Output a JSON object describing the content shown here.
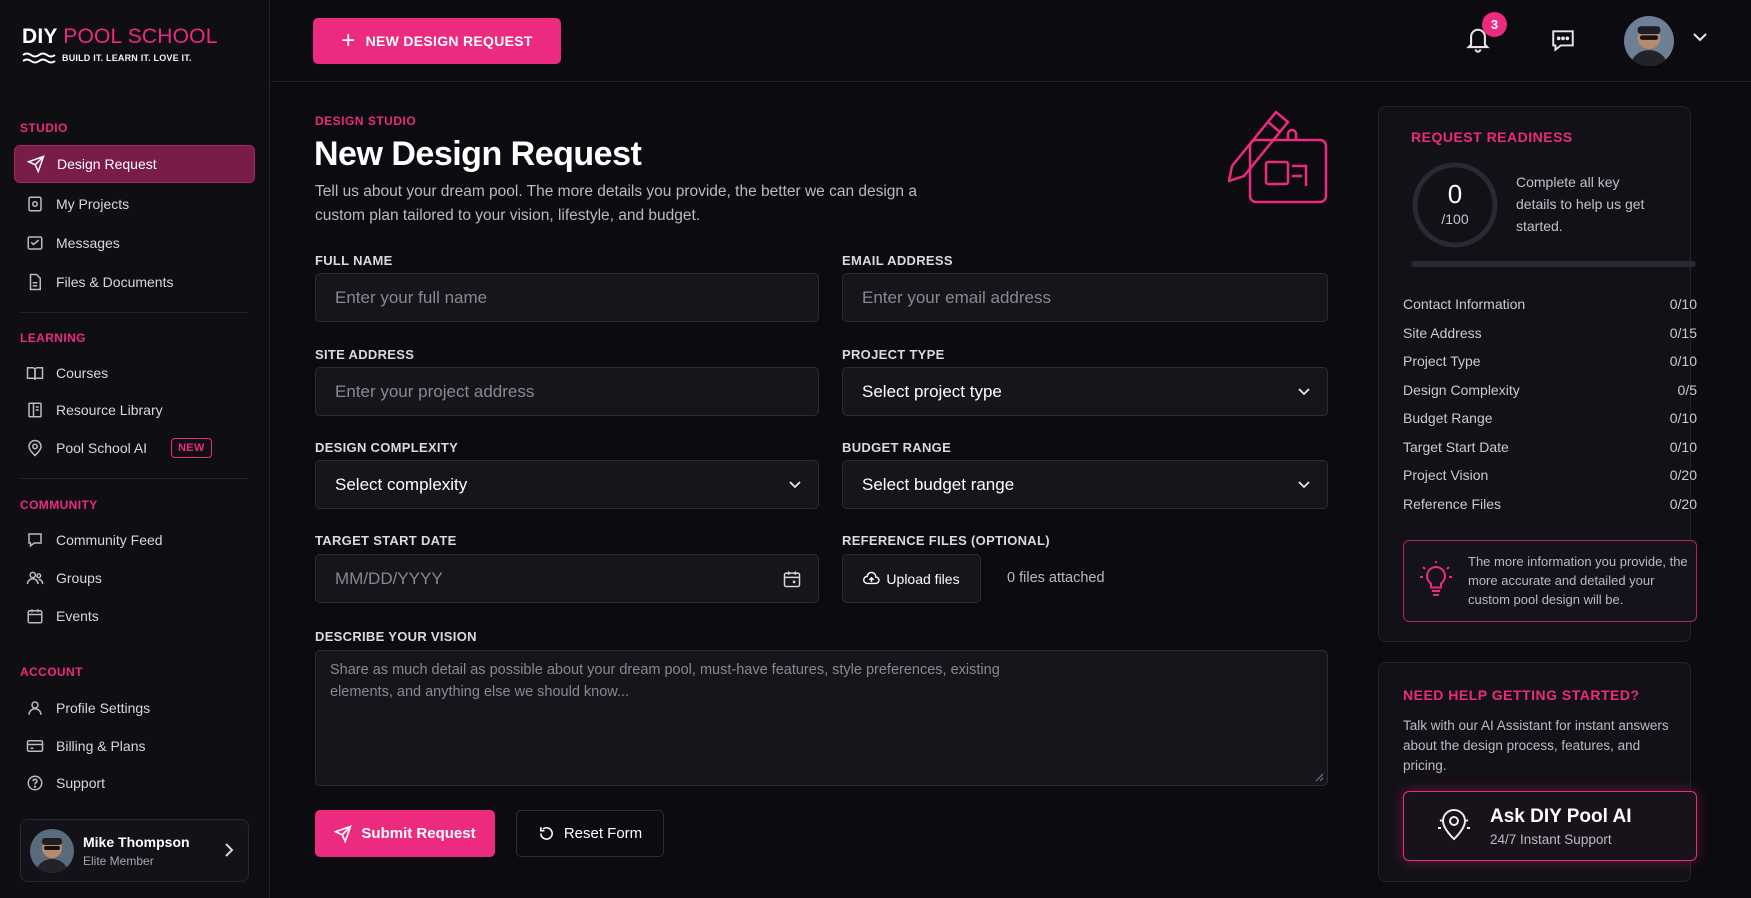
{
  "brand": {
    "name_part1": "DIY",
    "name_part2": "POOL SCHOOL",
    "tagline": "BUILD IT. LEARN IT. LOVE IT."
  },
  "sidebar": {
    "sections": [
      {
        "heading": "STUDIO",
        "items": [
          {
            "label": "Design Request",
            "icon": "send-icon",
            "active": true
          },
          {
            "label": "My Projects",
            "icon": "projects-icon"
          },
          {
            "label": "Messages",
            "icon": "messages-icon"
          },
          {
            "label": "Files & Documents",
            "icon": "file-icon"
          }
        ]
      },
      {
        "heading": "LEARNING",
        "items": [
          {
            "label": "Courses",
            "icon": "book-icon"
          },
          {
            "label": "Resource Library",
            "icon": "library-icon"
          },
          {
            "label": "Pool School AI",
            "icon": "ai-icon",
            "badge": "NEW"
          }
        ]
      },
      {
        "heading": "COMMUNITY",
        "items": [
          {
            "label": "Community Feed",
            "icon": "feed-icon"
          },
          {
            "label": "Groups",
            "icon": "groups-icon"
          },
          {
            "label": "Events",
            "icon": "calendar-icon"
          }
        ]
      },
      {
        "heading": "ACCOUNT",
        "items": [
          {
            "label": "Profile Settings",
            "icon": "user-icon"
          },
          {
            "label": "Billing & Plans",
            "icon": "billing-icon"
          },
          {
            "label": "Support",
            "icon": "help-icon"
          }
        ]
      }
    ],
    "user": {
      "name": "Mike Thompson",
      "role": "Elite Member"
    }
  },
  "topbar": {
    "new_button": "NEW DESIGN REQUEST",
    "notification_count": "3"
  },
  "main": {
    "kicker": "DESIGN STUDIO",
    "title": "New Design Request",
    "subtitle": "Tell us about your dream pool. The more details you provide, the better we can design a custom plan tailored to your vision, lifestyle, and budget.",
    "fields": {
      "full_name": {
        "label": "FULL NAME",
        "placeholder": "Enter your full name"
      },
      "email": {
        "label": "EMAIL ADDRESS",
        "placeholder": "Enter your email address"
      },
      "site_address": {
        "label": "SITE ADDRESS",
        "placeholder": "Enter your project address"
      },
      "project_type": {
        "label": "PROJECT TYPE",
        "value": "Select project type"
      },
      "complexity": {
        "label": "DESIGN COMPLEXITY",
        "value": "Select complexity"
      },
      "budget": {
        "label": "BUDGET RANGE",
        "value": "Select budget range"
      },
      "start_date": {
        "label": "TARGET START DATE",
        "placeholder": "MM/DD/YYYY"
      },
      "reference_files": {
        "label": "REFERENCE FILES (OPTIONAL)",
        "button": "Upload files",
        "status": "0 files attached"
      },
      "vision": {
        "label": "DESCRIBE YOUR VISION",
        "placeholder": "Share as much detail as possible about your dream pool, must-have features, style preferences, existing elements, and anything else we should know..."
      }
    },
    "submit": "Submit Request",
    "reset": "Reset Form"
  },
  "readiness": {
    "heading": "REQUEST READINESS",
    "score": "0",
    "score_max": "/100",
    "progress_fraction": 0,
    "message": "Complete all key details to help us get started.",
    "criteria": [
      {
        "label": "Contact Information",
        "value": "0/10"
      },
      {
        "label": "Site Address",
        "value": "0/15"
      },
      {
        "label": "Project Type",
        "value": "0/10"
      },
      {
        "label": "Design Complexity",
        "value": "0/5"
      },
      {
        "label": "Budget Range",
        "value": "0/10"
      },
      {
        "label": "Target Start Date",
        "value": "0/10"
      },
      {
        "label": "Project Vision",
        "value": "0/20"
      },
      {
        "label": "Reference Files",
        "value": "0/20"
      }
    ],
    "tip": "The more information you provide, the more accurate and detailed your custom pool design will be."
  },
  "help": {
    "heading": "NEED HELP GETTING STARTED?",
    "text": "Talk with our AI Assistant for instant answers about the design process, features, and pricing.",
    "button_title": "Ask DIY Pool AI",
    "button_sub": "24/7 Instant Support"
  },
  "colors": {
    "accent": "#ec2a7f",
    "background": "#0c0b0f",
    "panel": "#121117"
  }
}
